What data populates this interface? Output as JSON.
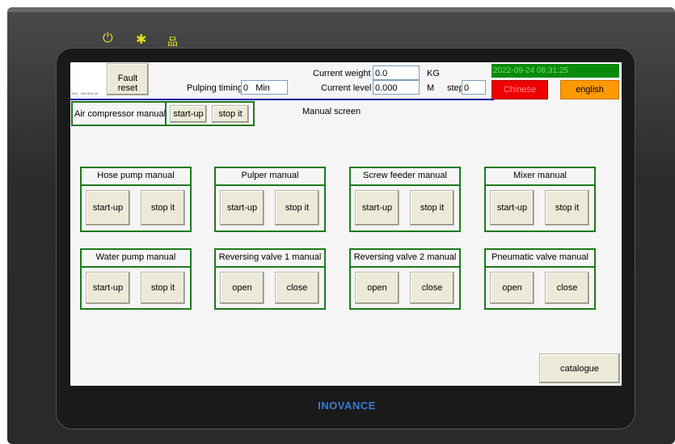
{
  "device": {
    "brand": "INOVANCE"
  },
  "top": {
    "fault_reset": "Fault reset",
    "pulping_timing_label": "Pulping timing",
    "pulping_timing_value": "0",
    "pulping_timing_unit": "Min",
    "current_weight_label": "Current weight",
    "current_weight_value": "0.0",
    "current_weight_unit": "KG",
    "current_level_label": "Current level",
    "current_level_value": "0.000",
    "current_level_unit": "M",
    "step_label": "step",
    "step_value": "0",
    "datetime": "2022-09-24 08:31:25",
    "chinese_label": "Chinese",
    "english_label": "english",
    "logo_tiny": "SCD - DW BOX W"
  },
  "air": {
    "label": "Air compressor manual",
    "start": "start-up",
    "stop": "stop it"
  },
  "title": "Manual screen",
  "groups": [
    {
      "title": "Hose pump manual",
      "a": "start-up",
      "b": "stop it"
    },
    {
      "title": "Pulper manual",
      "a": "start-up",
      "b": "stop it"
    },
    {
      "title": "Screw feeder manual",
      "a": "start-up",
      "b": "stop it"
    },
    {
      "title": "Mixer manual",
      "a": "start-up",
      "b": "stop it"
    },
    {
      "title": "Water pump manual",
      "a": "start-up",
      "b": "stop it"
    },
    {
      "title": "Reversing valve 1 manual",
      "a": "open",
      "b": "close"
    },
    {
      "title": "Reversing valve 2 manual",
      "a": "open",
      "b": "close"
    },
    {
      "title": "Pneumatic valve manual",
      "a": "open",
      "b": "close"
    }
  ],
  "catalogue": "catalogue",
  "colors": {
    "green_border": "#1e7a1e",
    "datetime_bg": "#0a8a0a",
    "chinese_bg": "#ee0000",
    "english_bg": "#ff9900"
  },
  "indicators": [
    "power-icon",
    "sun-icon",
    "network-icon"
  ]
}
